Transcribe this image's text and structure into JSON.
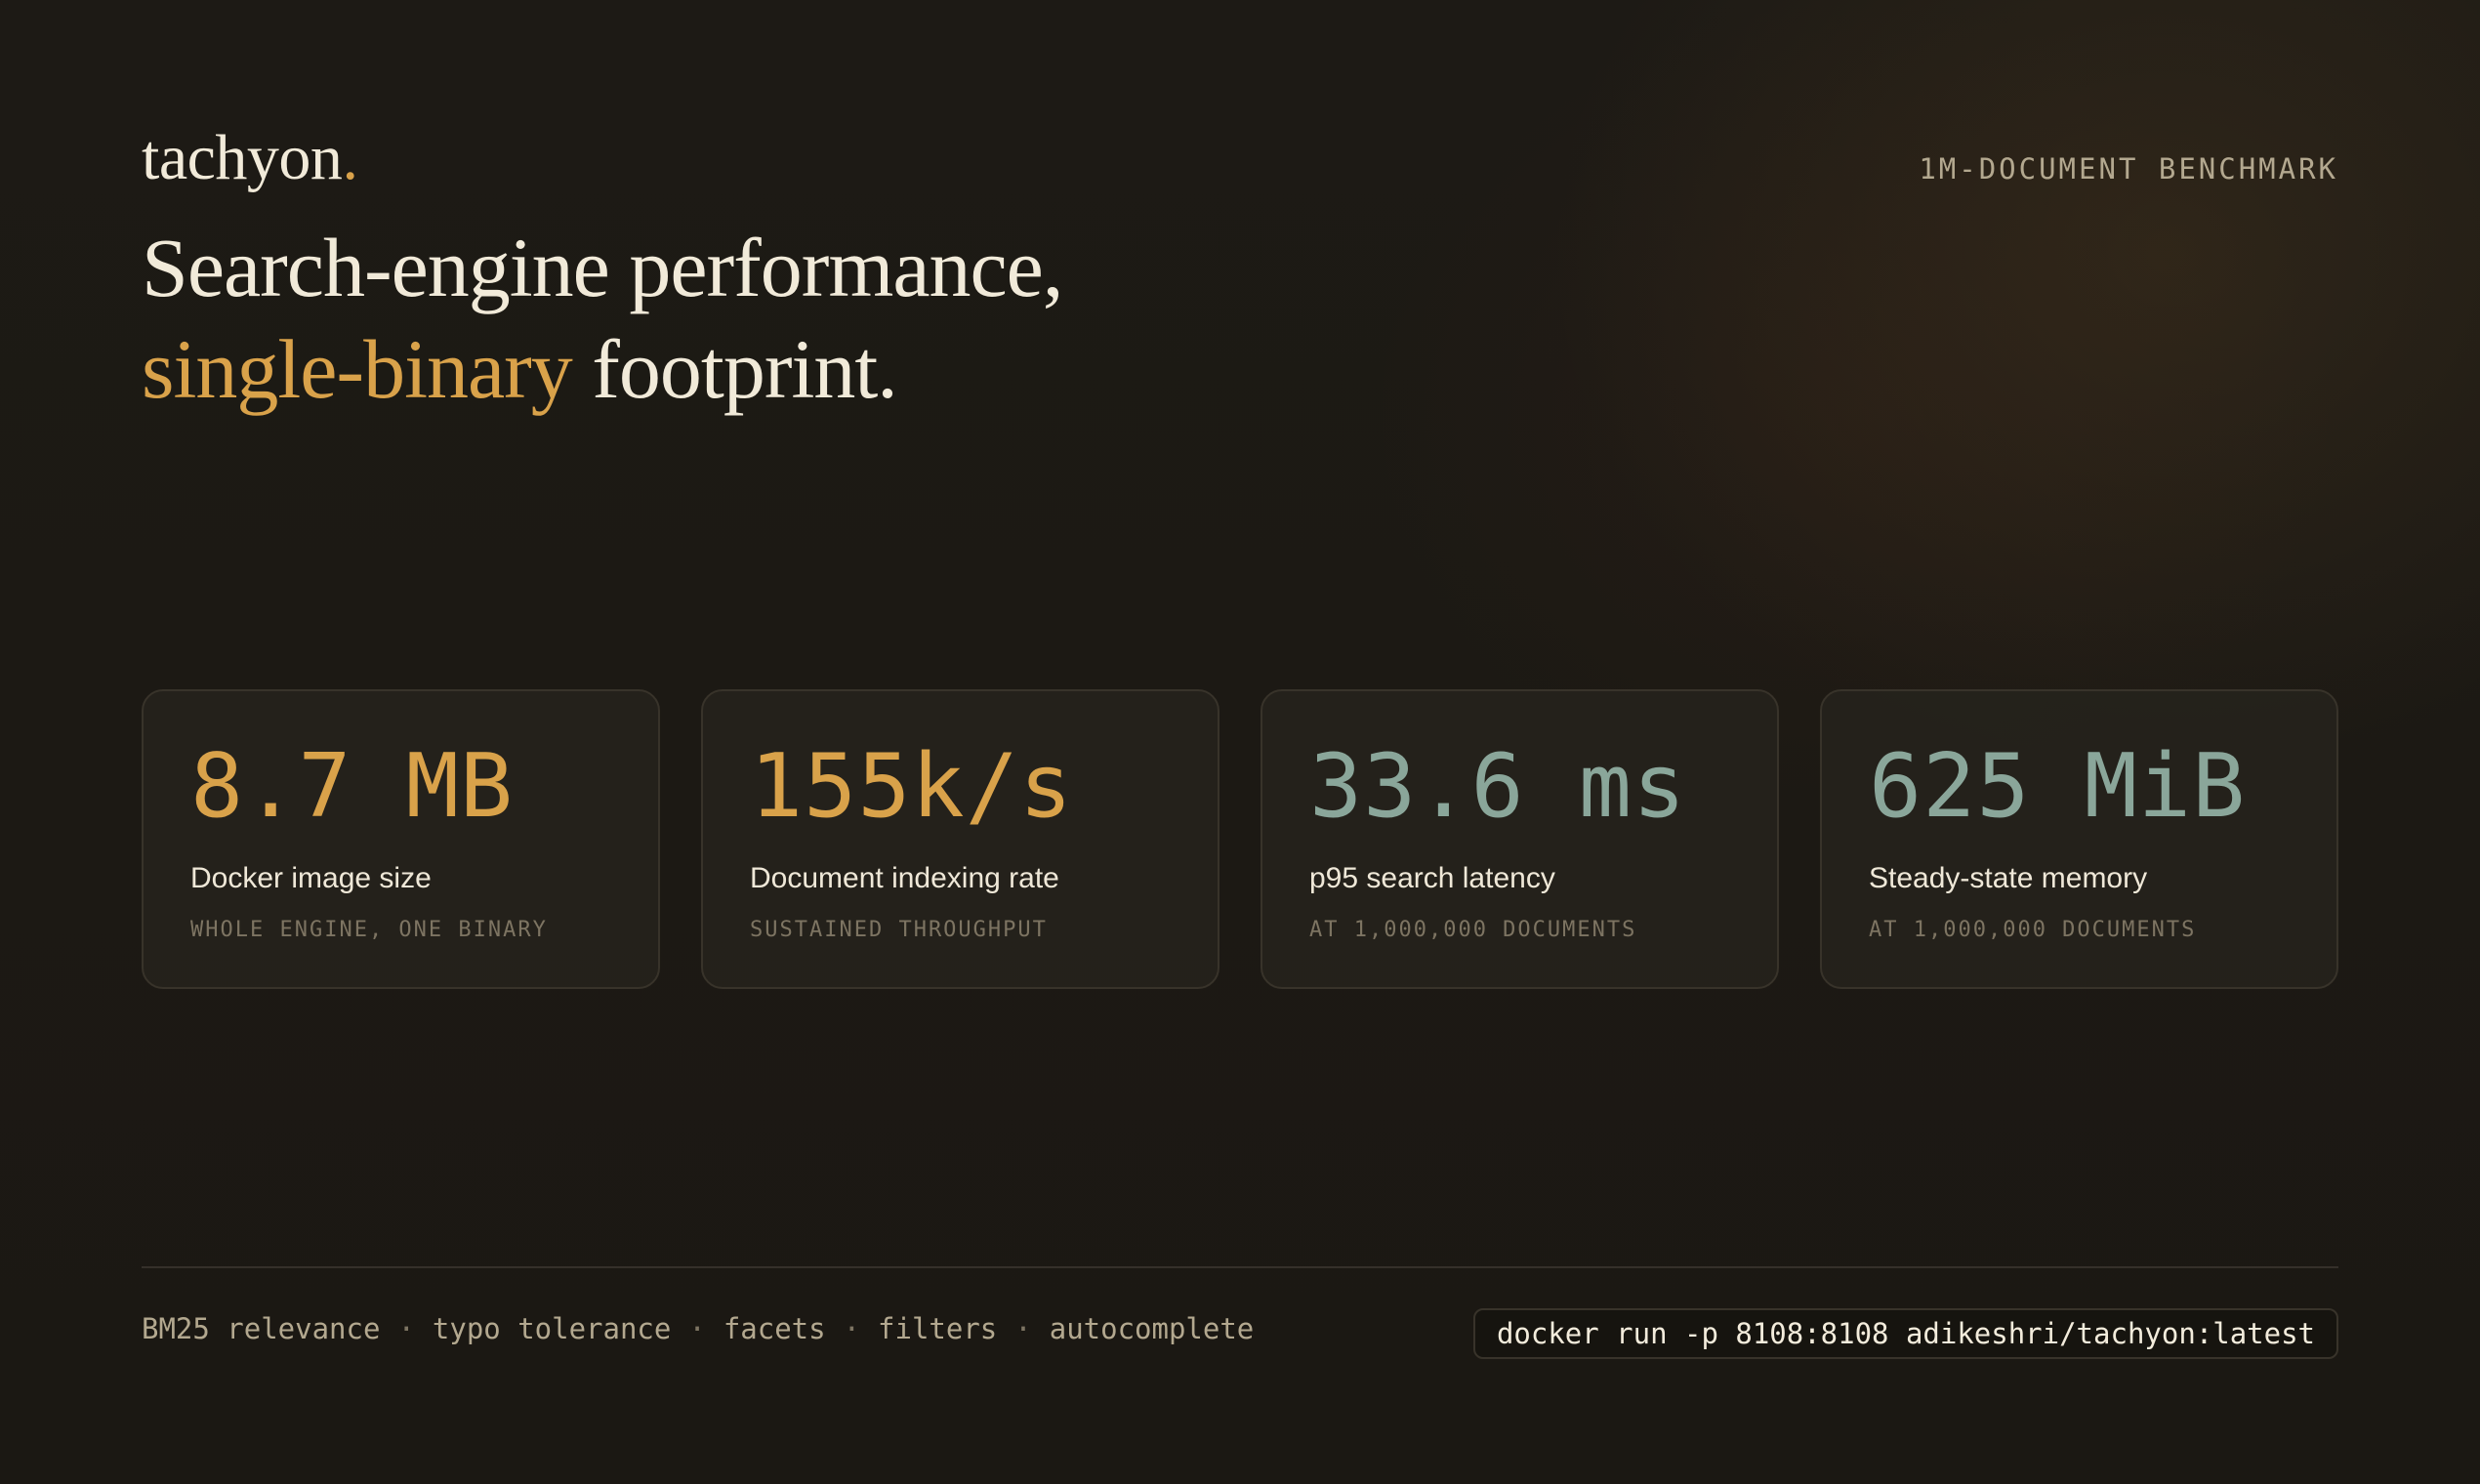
{
  "brand": {
    "name": "tachyon",
    "dot": "."
  },
  "badge": "1M-DOCUMENT BENCHMARK",
  "headline": {
    "line1": "Search-engine performance,",
    "accent": "single-binary",
    "line2_rest": " footprint."
  },
  "stats": [
    {
      "value": "8.7 MB",
      "label": "Docker image size",
      "note": "WHOLE ENGINE, ONE BINARY",
      "color": "#d9a24a"
    },
    {
      "value": "155k/s",
      "label": "Document indexing rate",
      "note": "SUSTAINED THROUGHPUT",
      "color": "#d9a24a"
    },
    {
      "value": "33.6 ms",
      "label": "p95 search latency",
      "note": "AT 1,000,000 DOCUMENTS",
      "color": "#8aa69a"
    },
    {
      "value": "625 MiB",
      "label": "Steady-state memory",
      "note": "AT 1,000,000 DOCUMENTS",
      "color": "#8aa69a"
    }
  ],
  "features": [
    "BM25 relevance",
    "typo tolerance",
    "facets",
    "filters",
    "autocomplete"
  ],
  "feature_separator": "·",
  "command": "docker run -p 8108:8108 adikeshri/tachyon:latest",
  "colors": {
    "background": "#1c1915",
    "accent_amber": "#d9a24a",
    "accent_sage": "#8aa69a",
    "text": "#efe8d8",
    "muted": "#b3a88f"
  }
}
